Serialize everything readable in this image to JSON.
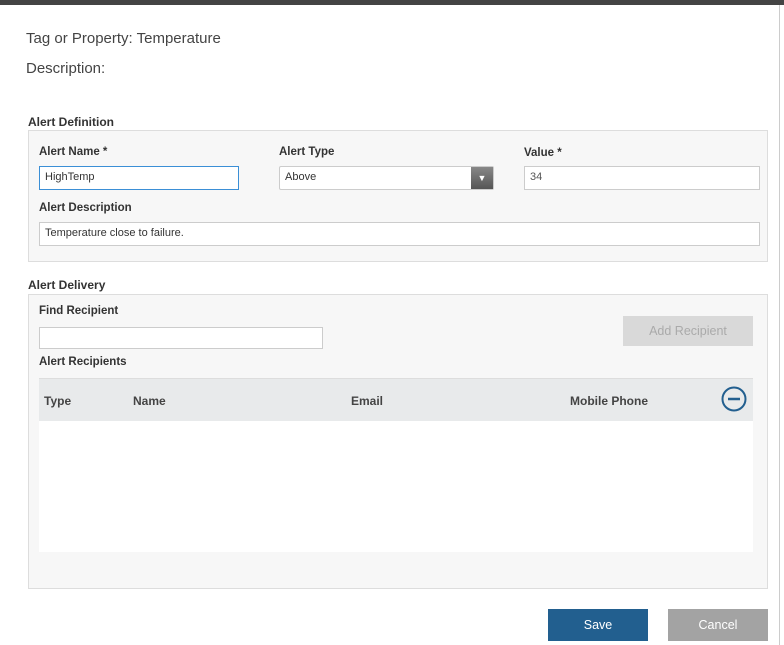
{
  "header": {
    "tag_property": "Tag or Property: Temperature",
    "description": "Description:"
  },
  "alert_definition": {
    "section_title": "Alert Definition",
    "name_label": "Alert Name *",
    "name_value": "HighTemp",
    "type_label": "Alert Type",
    "type_value": "Above",
    "value_label": "Value *",
    "value_value": "34",
    "description_label": "Alert Description",
    "description_value": "Temperature close to failure."
  },
  "alert_delivery": {
    "section_title": "Alert Delivery",
    "find_label": "Find Recipient",
    "find_value": "",
    "add_button": "Add Recipient",
    "recipients_label": "Alert Recipients",
    "columns": [
      "Type",
      "Name",
      "Email",
      "Mobile Phone"
    ],
    "rows": []
  },
  "footer": {
    "save": "Save",
    "cancel": "Cancel"
  },
  "colors": {
    "primary": "#225f8f",
    "secondary": "#a3a3a3"
  }
}
